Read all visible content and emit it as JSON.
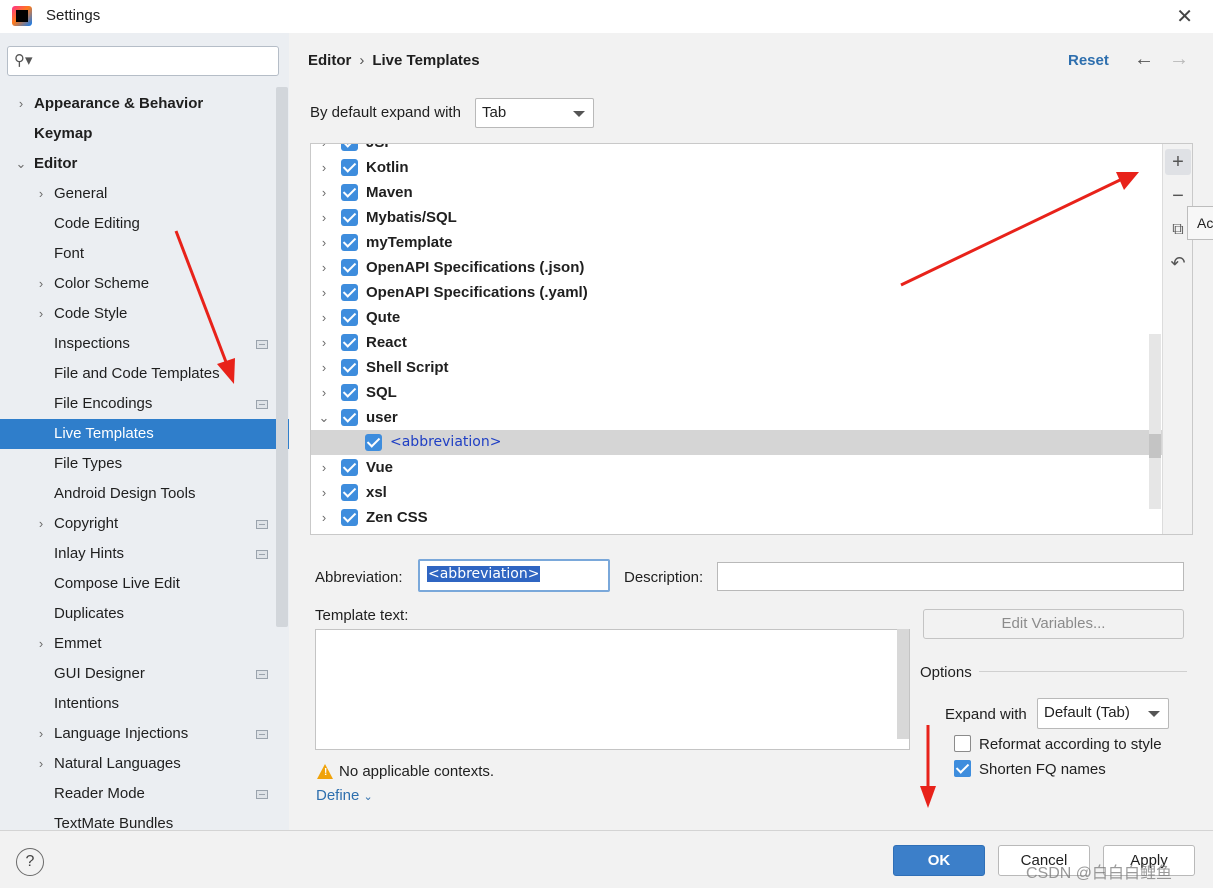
{
  "window": {
    "title": "Settings",
    "close_icon": "close-icon"
  },
  "sidebar": {
    "search_placeholder": "",
    "items": [
      {
        "label": "Appearance & Behavior",
        "level": 0,
        "chevron": "right"
      },
      {
        "label": "Keymap",
        "level": 0,
        "chevron": "none"
      },
      {
        "label": "Editor",
        "level": 0,
        "chevron": "down"
      },
      {
        "label": "General",
        "level": 1,
        "chevron": "right"
      },
      {
        "label": "Code Editing",
        "level": 1,
        "chevron": "none"
      },
      {
        "label": "Font",
        "level": 1,
        "chevron": "none"
      },
      {
        "label": "Color Scheme",
        "level": 1,
        "chevron": "right"
      },
      {
        "label": "Code Style",
        "level": 1,
        "chevron": "right"
      },
      {
        "label": "Inspections",
        "level": 1,
        "chevron": "none",
        "project": true
      },
      {
        "label": "File and Code Templates",
        "level": 1,
        "chevron": "none"
      },
      {
        "label": "File Encodings",
        "level": 1,
        "chevron": "none",
        "project": true
      },
      {
        "label": "Live Templates",
        "level": 1,
        "chevron": "none",
        "selected": true
      },
      {
        "label": "File Types",
        "level": 1,
        "chevron": "none"
      },
      {
        "label": "Android Design Tools",
        "level": 1,
        "chevron": "none"
      },
      {
        "label": "Copyright",
        "level": 1,
        "chevron": "right",
        "project": true
      },
      {
        "label": "Inlay Hints",
        "level": 1,
        "chevron": "none",
        "project": true
      },
      {
        "label": "Compose Live Edit",
        "level": 1,
        "chevron": "none"
      },
      {
        "label": "Duplicates",
        "level": 1,
        "chevron": "none"
      },
      {
        "label": "Emmet",
        "level": 1,
        "chevron": "right"
      },
      {
        "label": "GUI Designer",
        "level": 1,
        "chevron": "none",
        "project": true
      },
      {
        "label": "Intentions",
        "level": 1,
        "chevron": "none"
      },
      {
        "label": "Language Injections",
        "level": 1,
        "chevron": "right",
        "project": true
      },
      {
        "label": "Natural Languages",
        "level": 1,
        "chevron": "right"
      },
      {
        "label": "Reader Mode",
        "level": 1,
        "chevron": "none",
        "project": true
      },
      {
        "label": "TextMate Bundles",
        "level": 1,
        "chevron": "none"
      }
    ]
  },
  "header": {
    "breadcrumb": [
      "Editor",
      "Live Templates"
    ],
    "breadcrumb_sep": "›",
    "reset_label": "Reset"
  },
  "expand": {
    "label": "By default expand with",
    "value": "Tab"
  },
  "tree": {
    "rows": [
      {
        "label": "JSP",
        "checked": true,
        "chevron": "right"
      },
      {
        "label": "Kotlin",
        "checked": true,
        "chevron": "right"
      },
      {
        "label": "Maven",
        "checked": true,
        "chevron": "right"
      },
      {
        "label": "Mybatis/SQL",
        "checked": true,
        "chevron": "right"
      },
      {
        "label": "myTemplate",
        "checked": true,
        "chevron": "right"
      },
      {
        "label": "OpenAPI Specifications (.json)",
        "checked": true,
        "chevron": "right"
      },
      {
        "label": "OpenAPI Specifications (.yaml)",
        "checked": true,
        "chevron": "right"
      },
      {
        "label": "Qute",
        "checked": true,
        "chevron": "right"
      },
      {
        "label": "React",
        "checked": true,
        "chevron": "right"
      },
      {
        "label": "Shell Script",
        "checked": true,
        "chevron": "right"
      },
      {
        "label": "SQL",
        "checked": true,
        "chevron": "right"
      },
      {
        "label": "user",
        "checked": true,
        "chevron": "down"
      },
      {
        "label": "<abbreviation>",
        "checked": true,
        "chevron": "none",
        "child": true
      },
      {
        "label": "Vue",
        "checked": true,
        "chevron": "right"
      },
      {
        "label": "xsl",
        "checked": true,
        "chevron": "right"
      },
      {
        "label": "Zen CSS",
        "checked": true,
        "chevron": "right"
      }
    ],
    "toolbar": {
      "add": "+",
      "remove": "−",
      "copy": "⧉",
      "undo": "↶"
    },
    "tooltip": "Ac"
  },
  "details": {
    "abbreviation_label": "Abbreviation:",
    "abbreviation_value": "<abbreviation>",
    "description_label": "Description:",
    "description_value": "",
    "template_text_label": "Template text:",
    "edit_variables_label": "Edit Variables...",
    "options_title": "Options",
    "expand_with_label": "Expand with",
    "expand_with_value": "Default (Tab)",
    "reformat_label": "Reformat according to style",
    "reformat_checked": false,
    "shorten_label": "Shorten FQ names",
    "shorten_checked": true,
    "no_contexts": "No applicable contexts.",
    "define_label": "Define"
  },
  "footer": {
    "help": "?",
    "ok": "OK",
    "cancel": "Cancel",
    "apply": "Apply",
    "watermark": "CSDN @白白白鲤鱼"
  },
  "colors": {
    "accent": "#2f7ecb",
    "annotation": "#e8221a",
    "link": "#2e6fae"
  }
}
